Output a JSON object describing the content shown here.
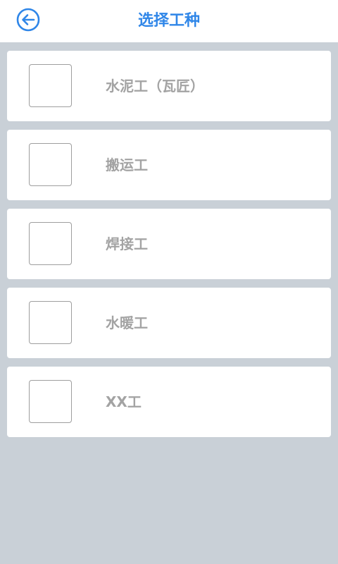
{
  "header": {
    "title": "选择工种",
    "back_icon": "arrow-left-circle-icon",
    "accent_color": "#2f86e8"
  },
  "options": [
    {
      "label": "水泥工（瓦匠）",
      "checked": false
    },
    {
      "label": "搬运工",
      "checked": false
    },
    {
      "label": "焊接工",
      "checked": false
    },
    {
      "label": "水暖工",
      "checked": false
    },
    {
      "label": "XX工",
      "checked": false
    }
  ]
}
